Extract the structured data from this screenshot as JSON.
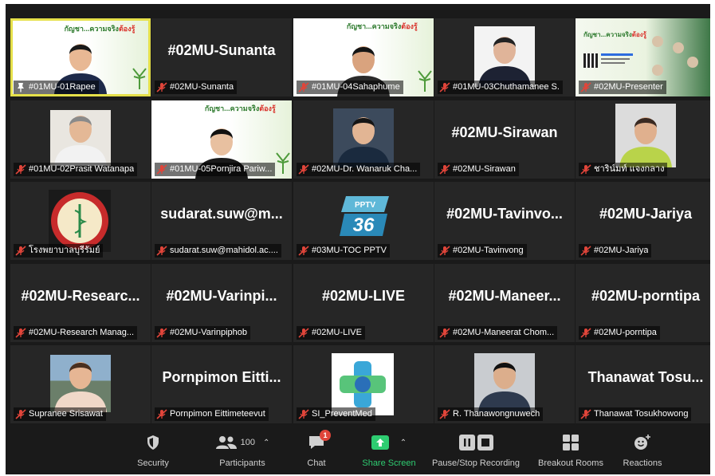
{
  "participants": [
    {
      "label": "#01MU-01Rapee",
      "display": "",
      "type": "video"
    },
    {
      "label": "#02MU-Sunanta",
      "display": "#02MU-Sunanta",
      "type": "name"
    },
    {
      "label": "#01MU-04Sahaphume",
      "display": "",
      "type": "video"
    },
    {
      "label": "#01MU-03Chuthamanee S.",
      "display": "",
      "type": "video"
    },
    {
      "label": "#02MU-Presenter",
      "display": "",
      "type": "video"
    },
    {
      "label": "#01MU-02Prasit Watanapa",
      "display": "",
      "type": "video"
    },
    {
      "label": "#01MU-05Pornjira Pariw...",
      "display": "",
      "type": "video"
    },
    {
      "label": "#02MU-Dr. Wanaruk Cha...",
      "display": "",
      "type": "video"
    },
    {
      "label": "#02MU-Sirawan",
      "display": "#02MU-Sirawan",
      "type": "name"
    },
    {
      "label": "ชาริน์มท์ แจงกลาง",
      "display": "",
      "type": "video"
    },
    {
      "label": "โรงพยาบาลบุรีรัมย์",
      "display": "",
      "type": "video"
    },
    {
      "label": "sudarat.suw@mahidol.ac....",
      "display": "sudarat.suw@m...",
      "type": "name"
    },
    {
      "label": "#03MU-TOC PPTV",
      "display": "",
      "type": "video"
    },
    {
      "label": "#02MU-Tavinvong",
      "display": "#02MU-Tavinvo...",
      "type": "name"
    },
    {
      "label": "#02MU-Jariya",
      "display": "#02MU-Jariya",
      "type": "name"
    },
    {
      "label": "#02MU-Research Manag...",
      "display": "#02MU-Researc...",
      "type": "name"
    },
    {
      "label": "#02MU-Varinpiphob",
      "display": "#02MU-Varinpi...",
      "type": "name"
    },
    {
      "label": "#02MU-LIVE",
      "display": "#02MU-LIVE",
      "type": "name"
    },
    {
      "label": "#02MU-Maneerat Chom...",
      "display": "#02MU-Maneer...",
      "type": "name"
    },
    {
      "label": "#02MU-porntipa",
      "display": "#02MU-porntipa",
      "type": "name"
    },
    {
      "label": "Supranee Srisawat",
      "display": "",
      "type": "video"
    },
    {
      "label": "Pornpimon Eittimeteevut",
      "display": "Pornpimon Eitti...",
      "type": "name"
    },
    {
      "label": "SI_PreventMed",
      "display": "",
      "type": "video"
    },
    {
      "label": "R. Thanawongnuwech",
      "display": "",
      "type": "video"
    },
    {
      "label": "Thanawat Tosukhowong",
      "display": "Thanawat Tosu...",
      "type": "name"
    }
  ],
  "banner": {
    "text": "กัญชา...ความจริง",
    "highlight": "ต้องรู้"
  },
  "pptv_logo": "PPTV 36",
  "toolbar": {
    "security": "Security",
    "participants": "Participants",
    "participants_count": "100",
    "chat": "Chat",
    "chat_badge": "1",
    "share": "Share Screen",
    "record": "Pause/Stop Recording",
    "breakout": "Breakout Rooms",
    "reactions": "Reactions"
  },
  "colors": {
    "background": "#1a1a1a",
    "tile": "#262626",
    "active_speaker": "#e5e04a",
    "share_green": "#2ecc71",
    "mute_red": "#e0453a"
  }
}
